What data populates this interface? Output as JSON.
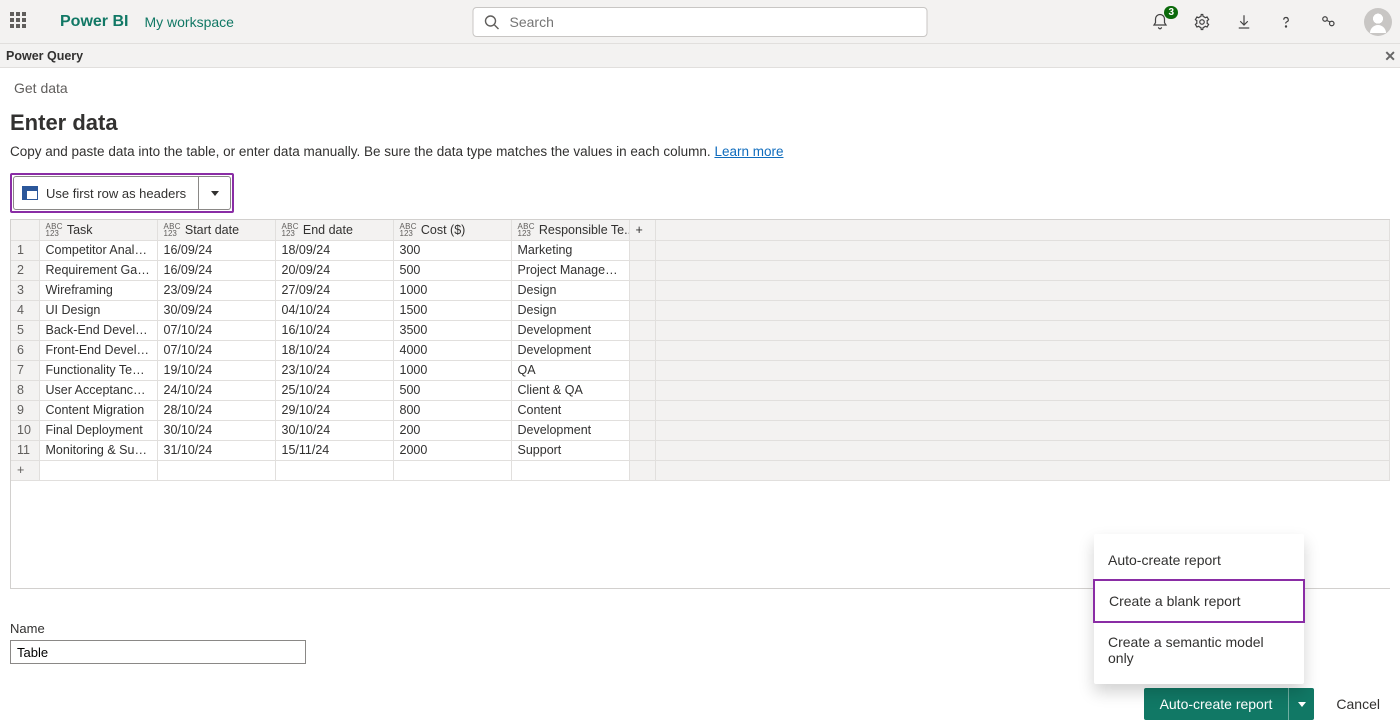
{
  "header": {
    "brand": "Power BI",
    "workspace": "My workspace",
    "search_placeholder": "Search",
    "notification_count": "3"
  },
  "powerquery_bar": "Power Query",
  "breadcrumb": "Get data",
  "page_title": "Enter data",
  "page_desc_prefix": "Copy and paste data into the table, or enter data manually. Be sure the data type matches the values in each column. ",
  "page_desc_link": "Learn more",
  "use_first_row_label": "Use first row as headers",
  "columns": [
    "Task",
    "Start date",
    "End date",
    "Cost ($)",
    "Responsible Te..."
  ],
  "rows": [
    [
      "Competitor Analysis",
      "16/09/24",
      "18/09/24",
      "300",
      "Marketing"
    ],
    [
      "Requirement Gathe...",
      "16/09/24",
      "20/09/24",
      "500",
      "Project Management"
    ],
    [
      "Wireframing",
      "23/09/24",
      "27/09/24",
      "1000",
      "Design"
    ],
    [
      "UI Design",
      "30/09/24",
      "04/10/24",
      "1500",
      "Design"
    ],
    [
      "Back-End Develop...",
      "07/10/24",
      "16/10/24",
      "3500",
      "Development"
    ],
    [
      "Front-End Develop...",
      "07/10/24",
      "18/10/24",
      "4000",
      "Development"
    ],
    [
      "Functionality Testing",
      "19/10/24",
      "23/10/24",
      "1000",
      "QA"
    ],
    [
      "User Acceptance T...",
      "24/10/24",
      "25/10/24",
      "500",
      "Client & QA"
    ],
    [
      "Content Migration",
      "28/10/24",
      "29/10/24",
      "800",
      "Content"
    ],
    [
      "Final Deployment",
      "30/10/24",
      "30/10/24",
      "200",
      "Development"
    ],
    [
      "Monitoring & Support",
      "31/10/24",
      "15/11/24",
      "2000",
      "Support"
    ]
  ],
  "name_field": {
    "label": "Name",
    "value": "Table"
  },
  "menu": {
    "items": [
      "Auto-create report",
      "Create a blank report",
      "Create a semantic model only"
    ],
    "selected_index": 1
  },
  "footer": {
    "primary": "Auto-create report",
    "cancel": "Cancel"
  }
}
